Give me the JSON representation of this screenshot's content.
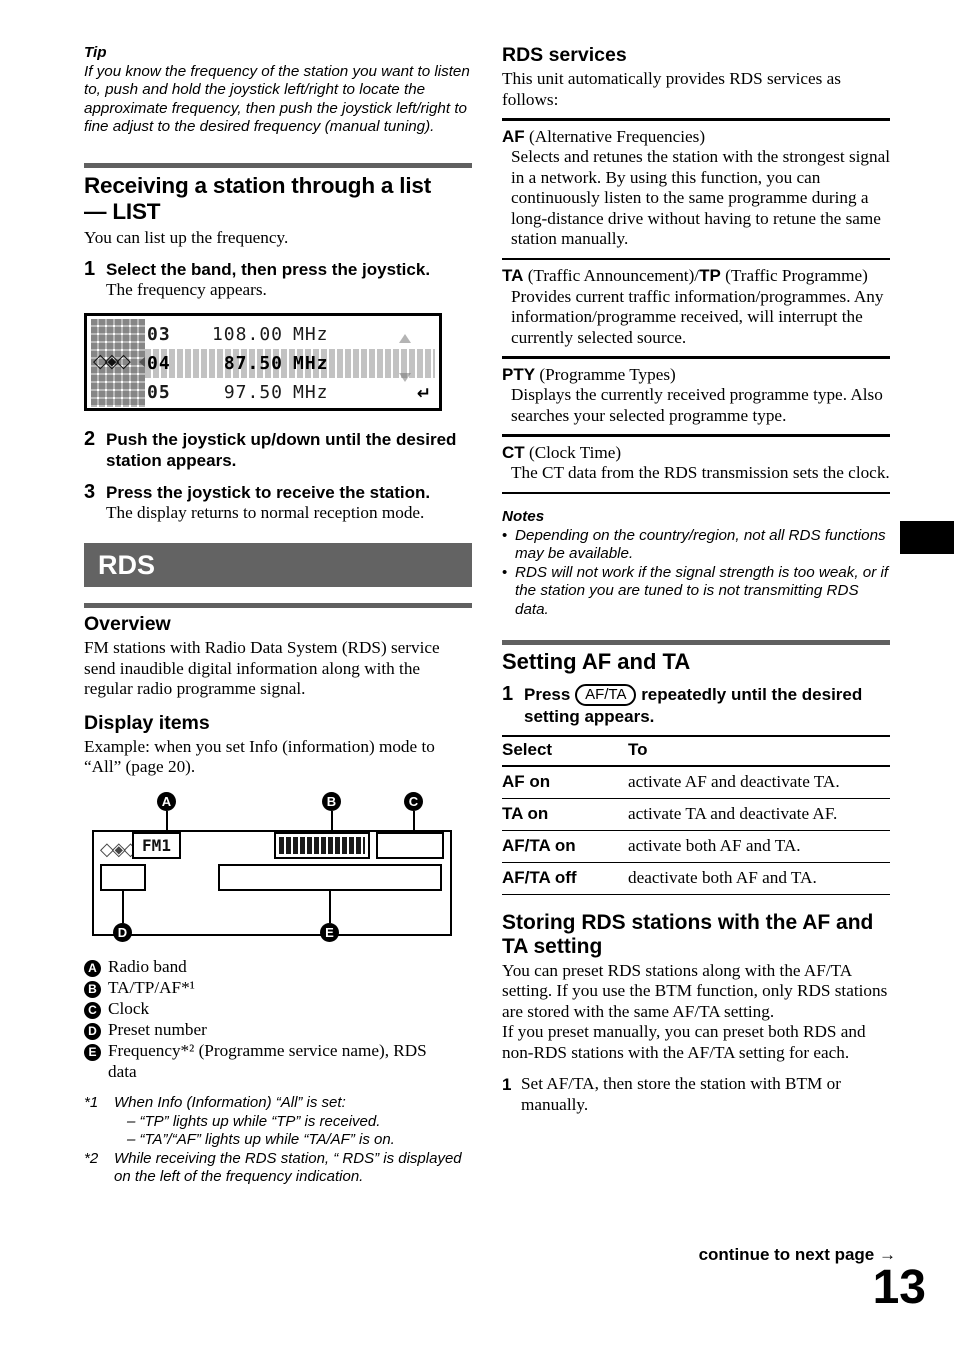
{
  "page": {
    "number": "13",
    "continue_label": "continue to next page",
    "continue_arrow": "→"
  },
  "left_column": {
    "tip": {
      "heading": "Tip",
      "text": "If you know the frequency of the station you want to listen to, push and hold the joystick left/right to locate the approximate frequency, then push the joystick left/right to fine adjust to the desired frequency (manual tuning)."
    },
    "list_section": {
      "heading_line1": "Receiving a station through a list",
      "heading_line2": "— LIST",
      "intro": "You can list up the frequency.",
      "steps": [
        {
          "num": "1",
          "title": "Select the band, then press the joystick.",
          "desc": "The frequency appears."
        },
        {
          "num": "2",
          "title": "Push the joystick up/down until the desired station appears.",
          "desc": ""
        },
        {
          "num": "3",
          "title": "Press the joystick to receive the station.",
          "desc": "The display returns to normal reception mode."
        }
      ],
      "lcd": {
        "rows": [
          {
            "preset": "03",
            "freq": "108.00",
            "unit": "MHz",
            "selected": false
          },
          {
            "preset": "04",
            "freq": "87.50",
            "unit": "MHz",
            "selected": true
          },
          {
            "preset": "05",
            "freq": "97.50",
            "unit": "MHz",
            "selected": false
          }
        ],
        "source_icon": "◇◈◇",
        "enter_icon": "↵"
      }
    },
    "rds_banner": "RDS",
    "overview": {
      "heading": "Overview",
      "text": "FM stations with Radio Data System (RDS) service send inaudible digital information along with the regular radio programme signal."
    },
    "display_items": {
      "heading": "Display items",
      "intro": "Example: when you set Info (information) mode to “All” (page 20).",
      "diagram": {
        "band_value": "FM1",
        "source_icon": "◇◈◇",
        "callouts": [
          "A",
          "B",
          "C",
          "D",
          "E"
        ]
      },
      "legend": [
        {
          "key": "A",
          "text": "Radio band"
        },
        {
          "key": "B",
          "text": "TA/TP/AF*¹"
        },
        {
          "key": "C",
          "text": "Clock"
        },
        {
          "key": "D",
          "text": "Preset number"
        },
        {
          "key": "E",
          "text": "Frequency*² (Programme service name), RDS data"
        }
      ],
      "footnotes": [
        {
          "mark": "*1",
          "lines": [
            "When Info (Information) “All” is set:",
            "– “TP” lights up while “TP” is received.",
            "– “TA”/“AF” lights up while “TA/AF” is on."
          ]
        },
        {
          "mark": "*2",
          "lines": [
            "While receiving the RDS station, “ RDS” is displayed on the left of the frequency indication."
          ]
        }
      ]
    }
  },
  "right_column": {
    "rds_services": {
      "heading": "RDS services",
      "intro": "This unit automatically provides RDS services as follows:",
      "entries": [
        {
          "abbr": "AF",
          "term_rest": " (Alternative Frequencies)",
          "desc": "Selects and retunes the station with the strongest signal in a network. By using this function, you can continuously listen to the same programme during a long-distance drive without having to retune the same station manually."
        },
        {
          "abbr": "TA",
          "term_rest": " (Traffic Announcement)/",
          "abbr2": "TP",
          "term_rest2": " (Traffic Programme)",
          "desc": "Provides current traffic information/programmes. Any information/programme received, will interrupt the currently selected source."
        },
        {
          "abbr": "PTY",
          "term_rest": " (Programme Types)",
          "desc": "Displays the currently received programme type. Also searches your selected programme type."
        },
        {
          "abbr": "CT",
          "term_rest": " (Clock Time)",
          "desc": "The CT data from the RDS transmission sets the clock."
        }
      ]
    },
    "notes": {
      "heading": "Notes",
      "items": [
        "Depending on the country/region, not all RDS functions may be available.",
        "RDS will not work if the signal strength is too weak, or if the station you are tuned to is not transmitting RDS data."
      ]
    },
    "setting_af_ta": {
      "heading": "Setting AF and TA",
      "step_num": "1",
      "step_before": "Press",
      "step_key": "AF/TA",
      "step_after": "repeatedly until the desired setting appears.",
      "table": {
        "columns": [
          "Select",
          "To"
        ],
        "rows": [
          [
            "AF on",
            "activate AF and deactivate TA."
          ],
          [
            "TA on",
            "activate TA and deactivate AF."
          ],
          [
            "AF/TA on",
            "activate both AF and TA."
          ],
          [
            "AF/TA off",
            "deactivate both AF and TA."
          ]
        ]
      }
    },
    "storing": {
      "heading_line1": "Storing RDS stations with the AF and",
      "heading_line2": "TA setting",
      "para1": "You can preset RDS stations along with the AF/TA setting. If you use the BTM function, only RDS stations are stored with the same AF/TA setting.",
      "para2": "If you preset manually, you can preset both RDS and non-RDS stations with the AF/TA setting for each.",
      "step_num": "1",
      "step_text": "Set AF/TA, then store the station with BTM or manually."
    }
  },
  "colors": {
    "banner_bg": "#636363",
    "rule": "#606060",
    "text": "#000000"
  }
}
